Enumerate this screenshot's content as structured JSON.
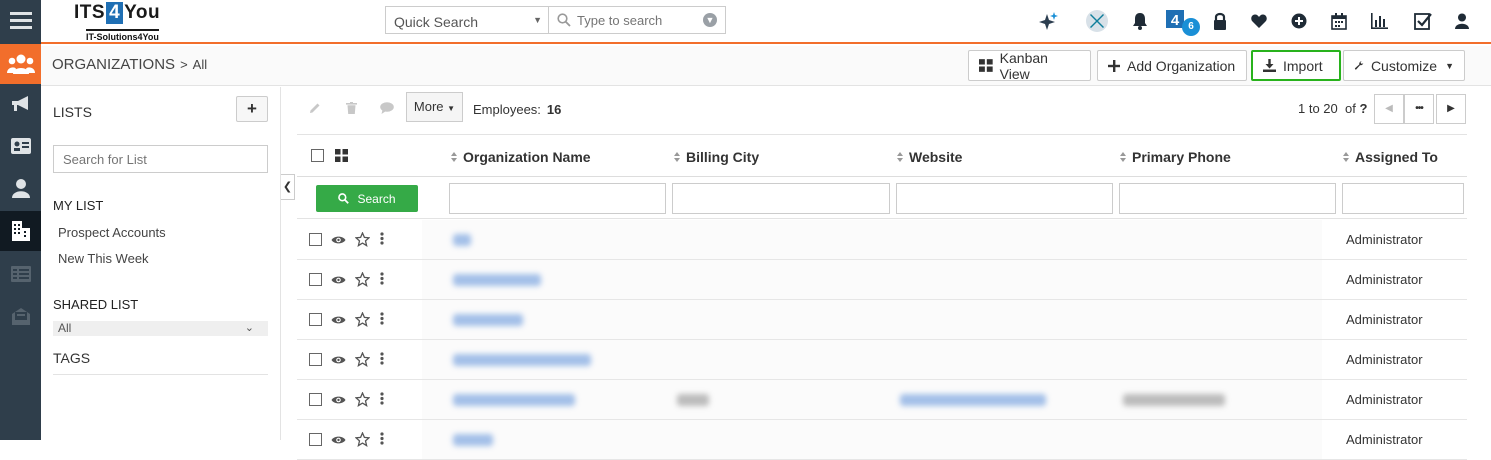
{
  "app": {
    "logo_main_a": "ITS",
    "logo_main_num": "4",
    "logo_main_b": "You",
    "logo_sub": "IT-Solutions4You",
    "accent": "#f26e2b",
    "rail_bg": "#2f3e4b"
  },
  "rail": {
    "items": [
      {
        "name": "menu-icon"
      },
      {
        "name": "organizations-module-icon",
        "active_color": "#f26e2b"
      },
      {
        "name": "megaphone-icon"
      },
      {
        "name": "contact-card-icon"
      },
      {
        "name": "user-icon"
      },
      {
        "name": "building-icon"
      },
      {
        "name": "list-icon"
      },
      {
        "name": "case-icon"
      }
    ]
  },
  "topbar": {
    "quick_search_select": "Quick Search",
    "search_placeholder": "Type to search",
    "notification_badge": "6",
    "icons": [
      "sparkle-icon",
      "extension-x-icon",
      "bell-icon",
      "its4you-icon",
      "lock-icon",
      "heart-icon",
      "plus-circle-icon",
      "calendar-icon",
      "bar-chart-icon",
      "checkbox-icon",
      "user-menu-icon"
    ]
  },
  "header": {
    "module": "ORGANIZATIONS",
    "separator": ">",
    "filter": "All",
    "kanban_label": "Kanban View",
    "add_label": "Add Organization",
    "import_label": "Import",
    "customize_label": "Customize"
  },
  "sidebar": {
    "lists_title": "LISTS",
    "add_symbol": "+",
    "search_placeholder": "Search for List",
    "my_list_title": "MY LIST",
    "my_list": [
      "Prospect Accounts",
      "New This Week"
    ],
    "shared_list_title": "SHARED LIST",
    "shared_selected": "All",
    "tags_title": "TAGS"
  },
  "toolbar": {
    "more_label": "More",
    "employees_label": "Employees:",
    "employees_value": "16",
    "paging_text": "1 to 20",
    "paging_of": "of",
    "paging_total": "?"
  },
  "table": {
    "columns": [
      "Organization Name",
      "Billing City",
      "Website",
      "Primary Phone",
      "Assigned To"
    ],
    "search_label": "Search",
    "rows": [
      {
        "assigned": "Administrator"
      },
      {
        "assigned": "Administrator"
      },
      {
        "assigned": "Administrator"
      },
      {
        "assigned": "Administrator"
      },
      {
        "assigned": "Administrator"
      },
      {
        "assigned": "Administrator"
      }
    ]
  }
}
